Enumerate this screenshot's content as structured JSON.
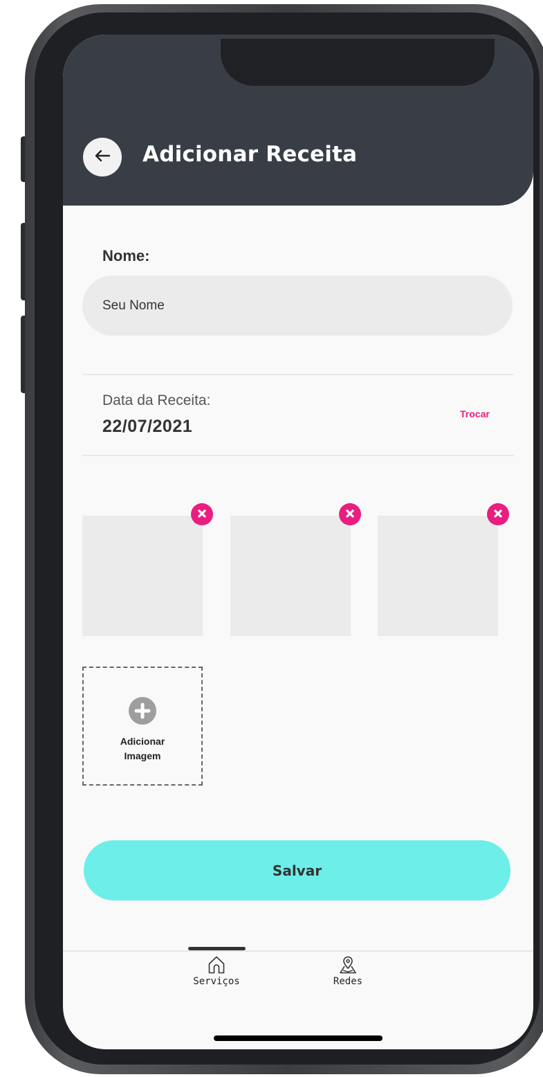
{
  "header": {
    "title": "Adicionar Receita"
  },
  "form": {
    "name_label": "Nome:",
    "name_placeholder": "Seu Nome",
    "name_value": "",
    "date_label": "Data da Receita:",
    "date_value": "22/07/2021",
    "change_date_label": "Trocar"
  },
  "images": {
    "count": 3,
    "add_label": "Adicionar\nImagem"
  },
  "actions": {
    "save_label": "Salvar"
  },
  "bottom_nav": {
    "items": [
      {
        "label": "Serviços",
        "icon": "home-icon",
        "active": true
      },
      {
        "label": "Redes",
        "icon": "map-pin-icon",
        "active": false
      }
    ]
  },
  "colors": {
    "header_bg": "#393e46",
    "accent_pink": "#e91e80",
    "save_button": "#6deee9",
    "screen_bg": "#f9f9f9"
  }
}
